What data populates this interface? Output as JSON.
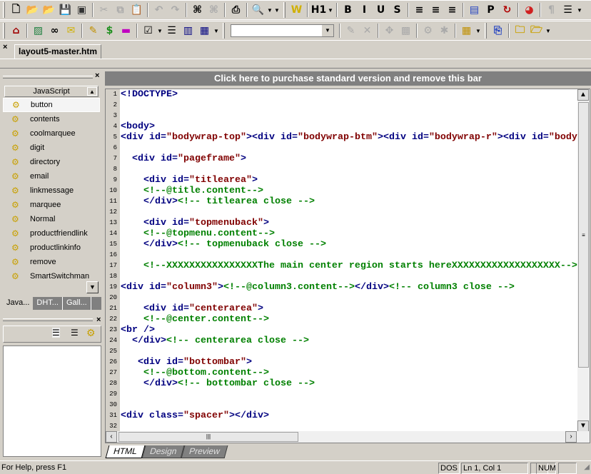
{
  "toolbar1": {
    "icons": [
      {
        "name": "new-file-icon",
        "g": "🗋",
        "c": "#000"
      },
      {
        "name": "open-folder-icon",
        "g": "📂",
        "c": "#c9a000"
      },
      {
        "name": "open-folder-up-icon",
        "g": "📂",
        "c": "#c9a000"
      },
      {
        "name": "save-icon",
        "g": "💾",
        "c": "#999",
        "dis": true
      },
      {
        "name": "save-all-icon",
        "g": "▣",
        "c": "#333"
      },
      {
        "sep": true
      },
      {
        "name": "cut-icon",
        "g": "✂",
        "c": "#aaa",
        "dis": true
      },
      {
        "name": "copy-icon",
        "g": "⧉",
        "c": "#aaa",
        "dis": true
      },
      {
        "name": "paste-icon",
        "g": "📋",
        "c": "#555"
      },
      {
        "sep": true
      },
      {
        "name": "undo-icon",
        "g": "↶",
        "c": "#aaa",
        "dis": true
      },
      {
        "name": "redo-icon",
        "g": "↷",
        "c": "#aaa",
        "dis": true
      },
      {
        "sep": true
      },
      {
        "name": "find-binoculars-icon",
        "g": "⌘",
        "c": "#000"
      },
      {
        "name": "replace-icon",
        "g": "⌘",
        "c": "#aaa",
        "dis": true
      },
      {
        "sep": true
      },
      {
        "name": "print-icon",
        "g": "⎙",
        "c": "#000"
      },
      {
        "sep": true
      },
      {
        "name": "preview-browser-icon",
        "g": "🔍",
        "c": "#2060a0"
      },
      {
        "dd": true
      },
      {
        "dd": true
      },
      {
        "grip": true
      },
      {
        "name": "word-w-icon",
        "g": "W",
        "c": "#d0b000"
      },
      {
        "sep": true
      },
      {
        "name": "heading-h1-icon",
        "g": "H1",
        "c": "#000"
      },
      {
        "dd": true
      },
      {
        "sep": true
      },
      {
        "name": "bold-icon",
        "g": "B",
        "c": "#000"
      },
      {
        "name": "italic-icon",
        "g": "I",
        "c": "#000"
      },
      {
        "name": "underline-icon",
        "g": "U",
        "c": "#000"
      },
      {
        "name": "strikethrough-icon",
        "g": "S",
        "c": "#000"
      },
      {
        "sep": true
      },
      {
        "name": "align-left-icon",
        "g": "≡",
        "c": "#000"
      },
      {
        "name": "align-center-icon",
        "g": "≡",
        "c": "#000"
      },
      {
        "name": "align-right-icon",
        "g": "≡",
        "c": "#000"
      },
      {
        "sep": true
      },
      {
        "name": "format-block-icon",
        "g": "▤",
        "c": "#2040c0"
      },
      {
        "name": "paragraph-p-icon",
        "g": "P",
        "c": "#000"
      },
      {
        "name": "refresh-icon",
        "g": "↻",
        "c": "#b00000"
      },
      {
        "sep": true
      },
      {
        "name": "color-picker-icon",
        "g": "◕",
        "c": "#d02020"
      },
      {
        "sep": true
      },
      {
        "name": "pilcrow-icon",
        "g": "¶",
        "c": "#aaa",
        "dis": true
      },
      {
        "name": "list-options-icon",
        "g": "☰",
        "c": "#000"
      },
      {
        "dd": true
      }
    ]
  },
  "toolbar2": {
    "icons": [
      {
        "name": "home-icon",
        "g": "⌂",
        "c": "#a00000"
      },
      {
        "sep": true
      },
      {
        "name": "image-icon",
        "g": "▨",
        "c": "#208040"
      },
      {
        "name": "link-icon",
        "g": "∞",
        "c": "#000"
      },
      {
        "name": "email-icon",
        "g": "✉",
        "c": "#d0b000"
      },
      {
        "sep": true
      },
      {
        "name": "pencil-icon",
        "g": "✎",
        "c": "#c09000"
      },
      {
        "name": "money-bag-icon",
        "g": "$",
        "c": "#209020"
      },
      {
        "name": "horizontal-rule-icon",
        "g": "▬",
        "c": "#c000c0"
      },
      {
        "sep": true
      },
      {
        "name": "form-controls-icon",
        "g": "☑",
        "c": "#000"
      },
      {
        "dd": true
      },
      {
        "name": "bullet-list-icon",
        "g": "☰",
        "c": "#000"
      },
      {
        "name": "layout-frame-icon",
        "g": "▥",
        "c": "#000080"
      },
      {
        "name": "table-icon",
        "g": "▦",
        "c": "#000080"
      },
      {
        "dd": true
      },
      {
        "grip": true
      },
      {
        "combo": true
      },
      {
        "sep": true
      },
      {
        "name": "edit-tag-icon",
        "g": "✎",
        "c": "#aaa",
        "dis": true
      },
      {
        "name": "delete-x-icon",
        "g": "✕",
        "c": "#aaa",
        "dis": true
      },
      {
        "sep": true
      },
      {
        "name": "snippet-icon",
        "g": "✥",
        "c": "#aaa",
        "dis": true
      },
      {
        "name": "gift-icon",
        "g": "▩",
        "c": "#aaa",
        "dis": true
      },
      {
        "sep": true
      },
      {
        "name": "script-icon",
        "g": "⚙",
        "c": "#aaa",
        "dis": true
      },
      {
        "name": "run-icon",
        "g": "✱",
        "c": "#aaa",
        "dis": true
      },
      {
        "sep": true
      },
      {
        "name": "insert-table-icon",
        "g": "▦",
        "c": "#c09000"
      },
      {
        "dd": true
      },
      {
        "grip": true
      },
      {
        "name": "ftp-icon",
        "g": "⎘",
        "c": "#2040c0"
      },
      {
        "sep": true
      },
      {
        "name": "folder-icon",
        "g": "🗀",
        "c": "#c9a000"
      },
      {
        "name": "folder-open-icon",
        "g": "🗁",
        "c": "#c9a000"
      },
      {
        "dd": true
      }
    ]
  },
  "document_tab": {
    "label": "layout5-master.htm"
  },
  "purchase_bar": {
    "text": "Click here to purchase standard version and remove this bar"
  },
  "left_panel": {
    "dropdown": "JavaScript",
    "items": [
      "button",
      "contents",
      "coolmarquee",
      "digit",
      "directory",
      "email",
      "linkmessage",
      "marquee",
      "Normal",
      "productfriendlink",
      "productlinkinfo",
      "remove",
      "SmartSwitchman"
    ],
    "selected": 0,
    "tabs": [
      "Java...",
      "DHT...",
      "Gall..."
    ]
  },
  "editor": {
    "lines": [
      [
        [
          "t",
          "<!DOCTYPE>"
        ]
      ],
      [],
      [],
      [
        [
          "t",
          "<body>"
        ]
      ],
      [
        [
          "t",
          "<div id="
        ],
        [
          "s",
          "\"bodywrap-top\""
        ],
        [
          "t",
          "><div id="
        ],
        [
          "s",
          "\"bodywrap-btm\""
        ],
        [
          "t",
          "><div id="
        ],
        [
          "s",
          "\"bodywrap-r\""
        ],
        [
          "t",
          "><div id="
        ],
        [
          "s",
          "\"body"
        ]
      ],
      [],
      [
        [
          "t",
          "  <div id="
        ],
        [
          "s",
          "\"pageframe\""
        ],
        [
          "t",
          ">"
        ]
      ],
      [],
      [
        [
          "t",
          "    <div id="
        ],
        [
          "s",
          "\"titlearea\""
        ],
        [
          "t",
          ">"
        ]
      ],
      [
        [
          "c",
          "    <!--@title.content-->"
        ]
      ],
      [
        [
          "t",
          "    </div>"
        ],
        [
          "c",
          "<!-- titlearea close -->"
        ]
      ],
      [],
      [
        [
          "t",
          "    <div id="
        ],
        [
          "s",
          "\"topmenuback\""
        ],
        [
          "t",
          ">"
        ]
      ],
      [
        [
          "c",
          "    <!--@topmenu.content-->"
        ]
      ],
      [
        [
          "t",
          "    </div>"
        ],
        [
          "c",
          "<!-- topmenuback close -->"
        ]
      ],
      [],
      [
        [
          "c",
          "    <!--XXXXXXXXXXXXXXXXThe main center region starts hereXXXXXXXXXXXXXXXXXXX-->"
        ]
      ],
      [],
      [
        [
          "t",
          "<div id="
        ],
        [
          "s",
          "\"column3\""
        ],
        [
          "t",
          ">"
        ],
        [
          "c",
          "<!--@column3.content-->"
        ],
        [
          "t",
          "</div>"
        ],
        [
          "c",
          "<!-- column3 close -->"
        ]
      ],
      [],
      [
        [
          "t",
          "    <div id="
        ],
        [
          "s",
          "\"centerarea\""
        ],
        [
          "t",
          ">"
        ]
      ],
      [
        [
          "c",
          "    <!--@center.content-->"
        ]
      ],
      [
        [
          "t",
          "<br />"
        ]
      ],
      [
        [
          "t",
          "  </div>"
        ],
        [
          "c",
          "<!-- centerarea close -->"
        ]
      ],
      [],
      [
        [
          "t",
          "   <div id="
        ],
        [
          "s",
          "\"bottombar\""
        ],
        [
          "t",
          ">"
        ]
      ],
      [
        [
          "c",
          "    <!--@bottom.content-->"
        ]
      ],
      [
        [
          "t",
          "    </div>"
        ],
        [
          "c",
          "<!-- bottombar close -->"
        ]
      ],
      [],
      [],
      [
        [
          "t",
          "<div class="
        ],
        [
          "s",
          "\"spacer\""
        ],
        [
          "t",
          "></div>"
        ]
      ],
      []
    ],
    "view_tabs": [
      "HTML",
      "Design",
      "Preview"
    ],
    "active_view": "HTML"
  },
  "status": {
    "help": "For Help, press F1",
    "line_ending": "DOS",
    "position": "Ln 1, Col 1",
    "num": "NUM"
  }
}
